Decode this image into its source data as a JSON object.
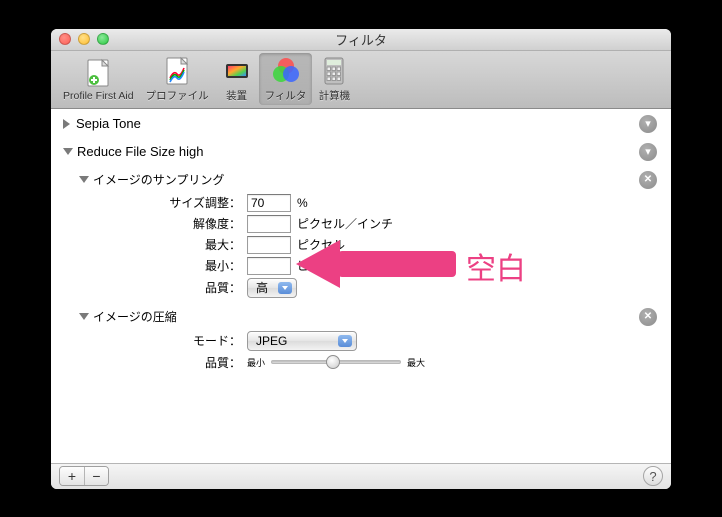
{
  "window": {
    "title": "フィルタ"
  },
  "toolbar": {
    "items": [
      {
        "label": "Profile First Aid"
      },
      {
        "label": "プロファイル"
      },
      {
        "label": "装置"
      },
      {
        "label": "フィルタ"
      },
      {
        "label": "計算機"
      }
    ]
  },
  "filters": {
    "sepia": {
      "title": "Sepia Tone"
    },
    "reduce": {
      "title": "Reduce File Size high",
      "sampling": {
        "title": "イメージのサンプリング",
        "size_label": "サイズ調整：",
        "size_value": "70",
        "size_unit": "%",
        "res_label": "解像度：",
        "res_value": "",
        "res_unit": "ピクセル／インチ",
        "max_label": "最大：",
        "max_value": "",
        "max_unit": "ピクセル",
        "min_label": "最小：",
        "min_value": "",
        "min_unit": "ピクセル",
        "quality_label": "品質：",
        "quality_value": "高"
      },
      "compression": {
        "title": "イメージの圧縮",
        "mode_label": "モード：",
        "mode_value": "JPEG",
        "quality_label": "品質：",
        "slider_min": "最小",
        "slider_max": "最大"
      }
    }
  },
  "annotation": {
    "label": "空白"
  },
  "footer": {
    "plus": "+",
    "minus": "−",
    "help": "?"
  }
}
